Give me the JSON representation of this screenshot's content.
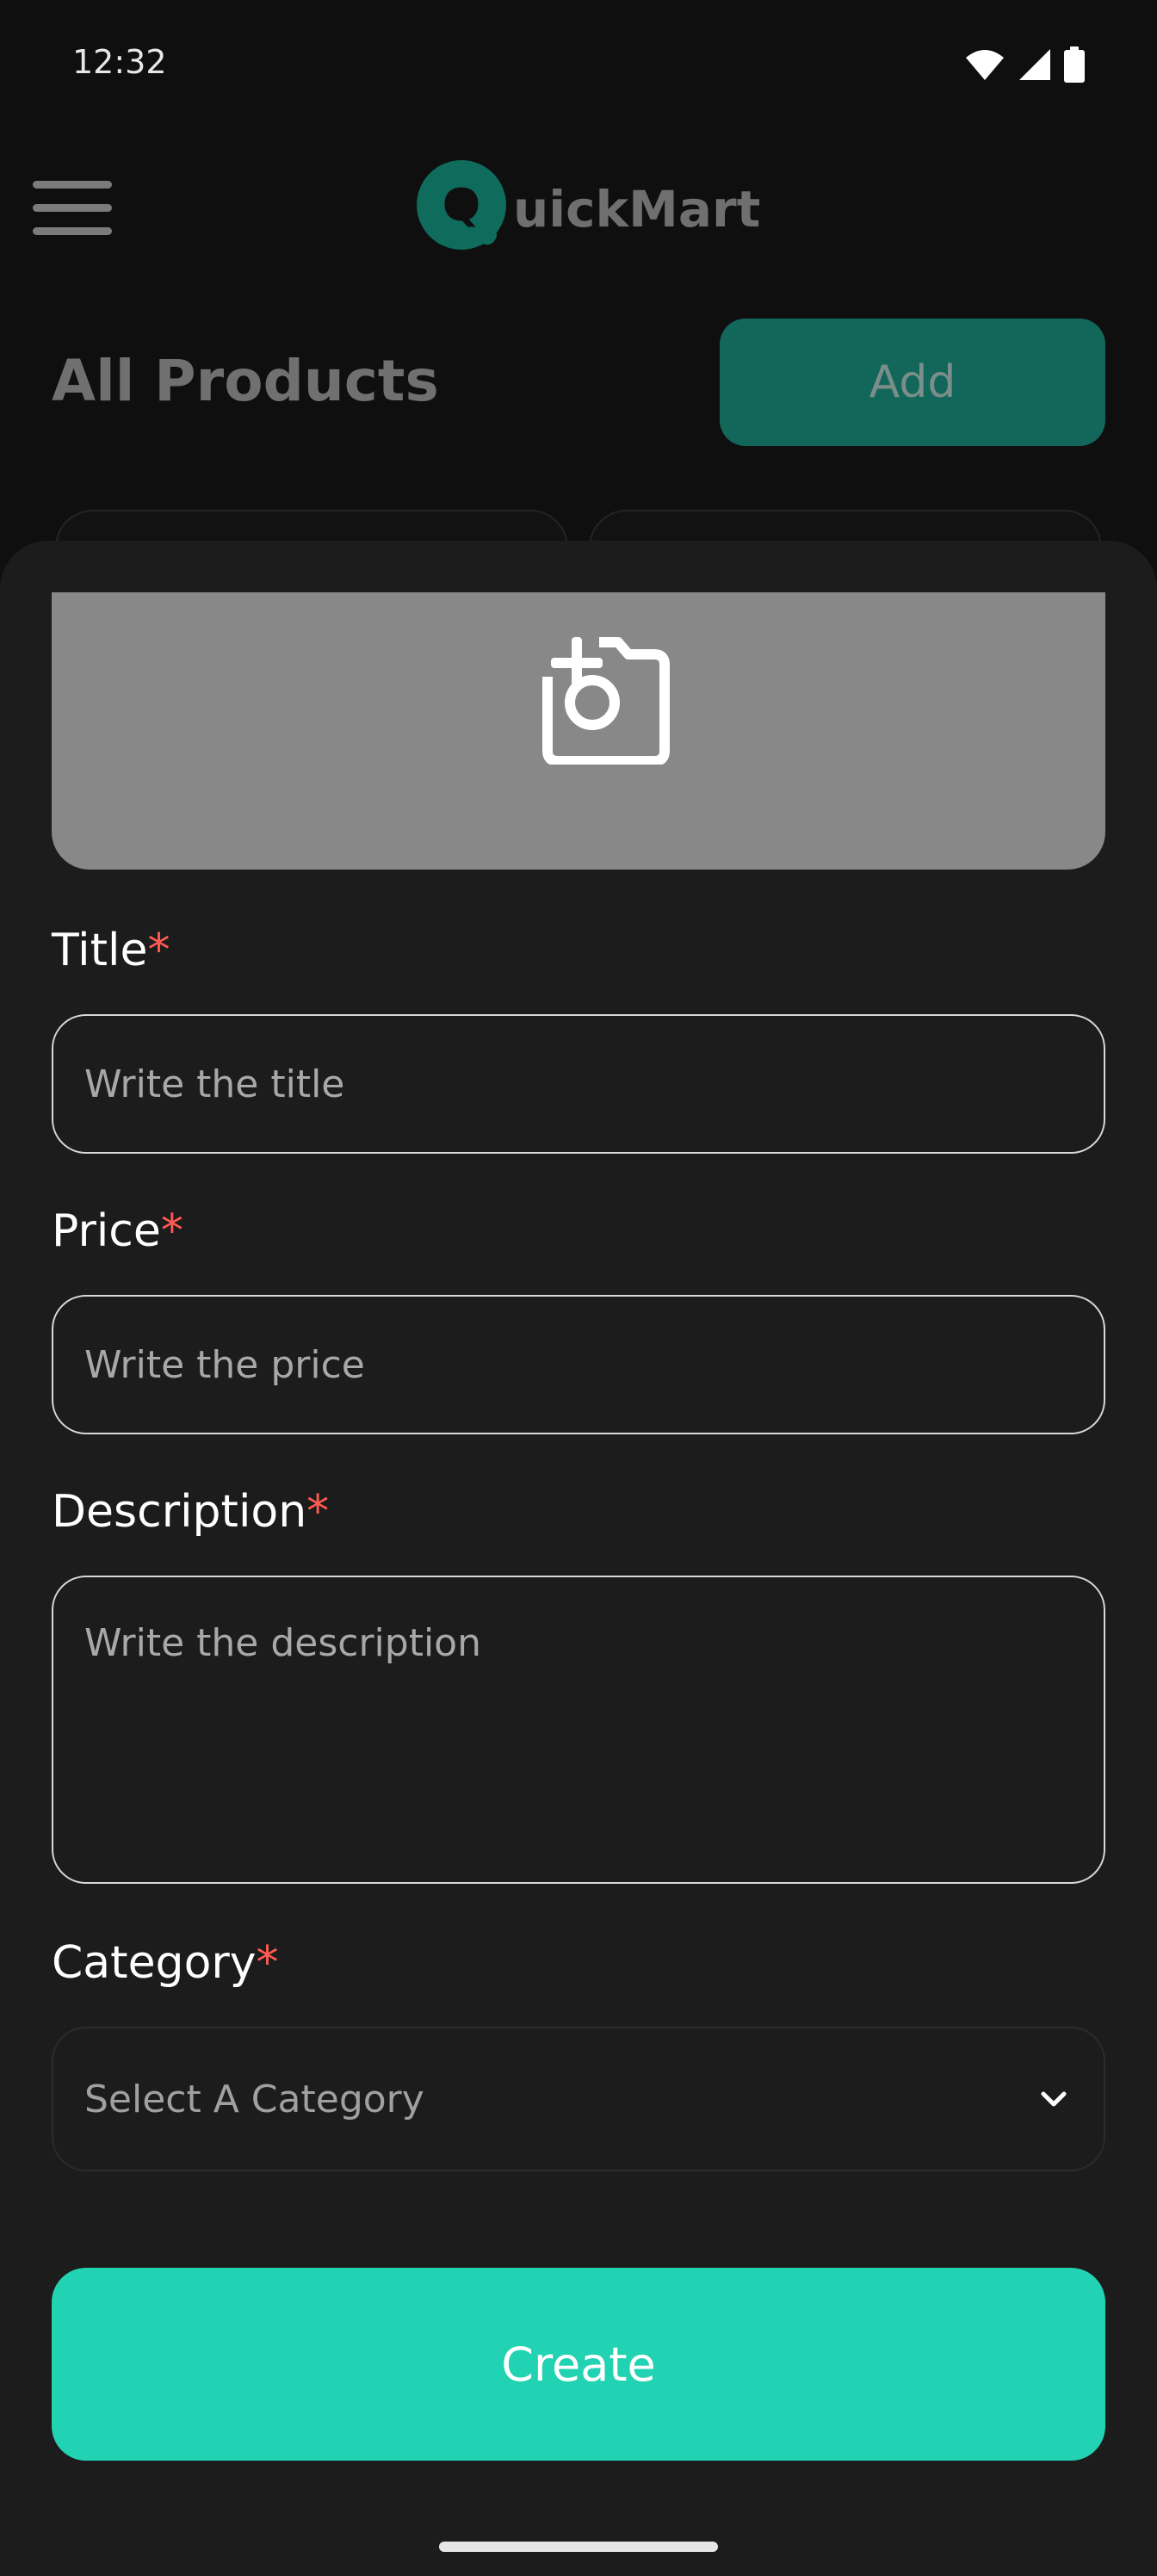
{
  "status_bar": {
    "time": "12:32"
  },
  "app_bar": {
    "brand_name": "uickMart",
    "brand_initial": "Q"
  },
  "page": {
    "title": "All Products",
    "add_label": "Add"
  },
  "form": {
    "title_label": "Title",
    "title_placeholder": "Write the title",
    "price_label": "Price",
    "price_placeholder": "Write the price",
    "description_label": "Description",
    "description_placeholder": "Write the description",
    "category_label": "Category",
    "category_selected": "Select A Category",
    "required_marker": "*",
    "create_label": "Create"
  },
  "colors": {
    "accent": "#21d3b2",
    "dim_accent": "#13675a",
    "required": "#ff5b52",
    "sheet_bg": "#1c1c1c"
  },
  "icons": {
    "menu": "menu-icon",
    "camera": "add-photo-icon",
    "chevron": "chevron-down-icon",
    "wifi": "wifi-icon",
    "signal": "signal-icon",
    "battery": "battery-icon"
  }
}
